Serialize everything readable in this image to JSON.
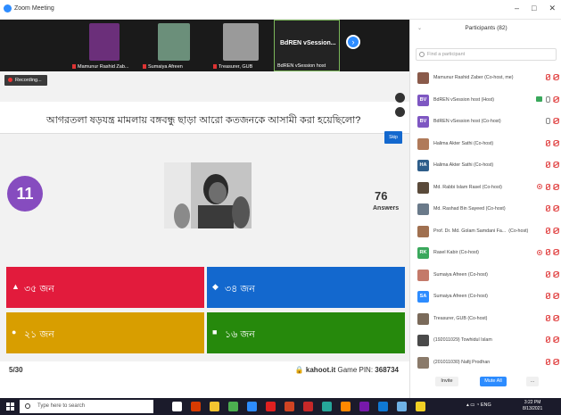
{
  "window": {
    "title": "Zoom Meeting",
    "controls": [
      "–",
      "□",
      "✕"
    ]
  },
  "video_tiles": [
    {
      "name": "Mamunur Rashid Zab...",
      "muted": true
    },
    {
      "name": "Sumaiya Afreen",
      "muted": true
    },
    {
      "name": "Treasurer, GUB",
      "muted": true
    },
    {
      "name": "BdREN vSession host",
      "big_label": "BdREN vSession...",
      "muted": false
    }
  ],
  "recording_label": "Recording...",
  "quiz": {
    "question": "আগরতলা ষড়যন্ত্র মামলায় বঙ্গবন্ধু ছাড়া আরো কতজনকে আসামী করা হয়েছিলো?",
    "skip_label": "Skip",
    "timer": "11",
    "answers_count": "76",
    "answers_label": "Answers",
    "options": [
      {
        "symbol": "▲",
        "label": "৩৫ জন",
        "color": "#e21b3c"
      },
      {
        "symbol": "◆",
        "label": "৩৪ জন",
        "color": "#1368ce"
      },
      {
        "symbol": "●",
        "label": "২১ জন",
        "color": "#d89e00"
      },
      {
        "symbol": "■",
        "label": "১৬ জন",
        "color": "#26890c"
      }
    ],
    "progress": "5/30",
    "site": "kahoot.it",
    "pin_label": "Game PIN:",
    "pin": "368734"
  },
  "participants_panel": {
    "title": "Participants (82)",
    "search_placeholder": "Find a participant",
    "participants": [
      {
        "name": "Mamunur Rashid Zaber (Co-host, me)",
        "avatar": "",
        "avatar_color": "#8a5a4a",
        "mic": "off",
        "cam": "off"
      },
      {
        "name": "BdREN vSession host (Host)",
        "avatar": "BV",
        "avatar_color": "#7e57c2",
        "mic": "on",
        "cam": "off",
        "sharing": true
      },
      {
        "name": "BdREN vSession host (Co-host)",
        "avatar": "BV",
        "avatar_color": "#7e57c2",
        "mic": "on",
        "cam": "off"
      },
      {
        "name": "Halima Akter Sathi (Co-host)",
        "avatar": "",
        "avatar_color": "#b07a5a",
        "mic": "off",
        "cam": "off"
      },
      {
        "name": "Halima Akter Sathi (Co-host)",
        "avatar": "HA",
        "avatar_color": "#2e5d8a",
        "mic": "off",
        "cam": "off"
      },
      {
        "name": "Md. Rabbi Islam Rasel (Co-host)",
        "avatar": "",
        "avatar_color": "#5a4a3a",
        "mic": "off",
        "cam": "off",
        "cam_extra": true
      },
      {
        "name": "Md. Rashad Bin Sayeed (Co-host)",
        "avatar": "",
        "avatar_color": "#6a7a8a",
        "mic": "off",
        "cam": "off"
      },
      {
        "name": "Prof. Dr. Md. Golam Samdani Fa...",
        "role_suffix": "(Co-host)",
        "avatar": "",
        "avatar_color": "#a07050",
        "mic": "off",
        "cam": "off"
      },
      {
        "name": "Rasel Kabir (Co-host)",
        "avatar": "RK",
        "avatar_color": "#3aa85c",
        "mic": "off",
        "cam": "off",
        "cam_extra": true
      },
      {
        "name": "Sumaiya Afreen (Co-host)",
        "avatar": "",
        "avatar_color": "#c47a6a",
        "mic": "off",
        "cam": "off"
      },
      {
        "name": "Sumaiya Afreen (Co-host)",
        "avatar": "SA",
        "avatar_color": "#2d8cff",
        "mic": "off",
        "cam": "off"
      },
      {
        "name": "Treasurer, GUB (Co-host)",
        "avatar": "",
        "avatar_color": "#7a6a5a",
        "mic": "off",
        "cam": "off"
      },
      {
        "name": "(192011029) Towhidul Islam",
        "avatar": "",
        "avatar_color": "#4a4a4a",
        "mic": "off",
        "cam": "off"
      },
      {
        "name": "(201011030) Nafij Prodhan",
        "avatar": "",
        "avatar_color": "#8a7a6a",
        "mic": "off",
        "cam": "off"
      }
    ],
    "invite_label": "Invite",
    "mute_all_label": "Mute All",
    "more_label": "..."
  },
  "taskbar": {
    "search_placeholder": "Type here to search",
    "tray_text": "ENG",
    "time": "3:22 PM",
    "date": "8/13/2021",
    "apps": [
      {
        "icon": "task-view-icon",
        "color": "#ffffff"
      },
      {
        "icon": "office-icon",
        "color": "#d83b01"
      },
      {
        "icon": "file-explorer-icon",
        "color": "#f4c430"
      },
      {
        "icon": "chrome-icon",
        "color": "#4caf50"
      },
      {
        "icon": "zoom-icon",
        "color": "#2d8cff"
      },
      {
        "icon": "acrobat-icon",
        "color": "#e02020"
      },
      {
        "icon": "powerpoint-icon",
        "color": "#d04423"
      },
      {
        "icon": "app-red-icon",
        "color": "#c62828"
      },
      {
        "icon": "paint-icon",
        "color": "#26a69a"
      },
      {
        "icon": "vlc-icon",
        "color": "#ff8800"
      },
      {
        "icon": "onenote-icon",
        "color": "#7719aa"
      },
      {
        "icon": "edge-icon",
        "color": "#0f78d4"
      },
      {
        "icon": "notepad-icon",
        "color": "#6fb1e6"
      },
      {
        "icon": "sticky-notes-icon",
        "color": "#f2d024"
      }
    ]
  }
}
